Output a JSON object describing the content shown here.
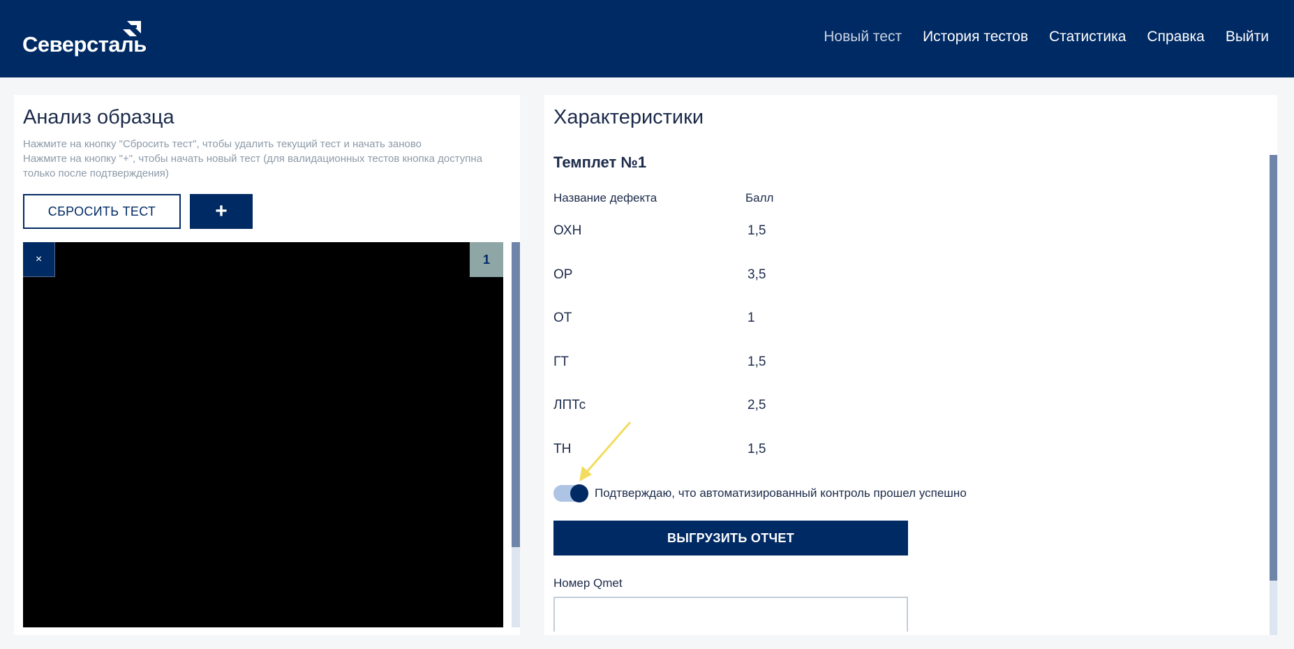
{
  "header": {
    "logo_text": "Северсталь",
    "nav": [
      "Новый тест",
      "История тестов",
      "Статистика",
      "Справка",
      "Выйти"
    ]
  },
  "left_panel": {
    "title": "Анализ образца",
    "hint_lines": [
      "Нажмите на кнопку \"Сбросить тест\", чтобы удалить текущий тест и начать заново",
      "Нажмите на кнопку \"+\", чтобы начать новый тест (для валидационных тестов кнопка доступна только после подтверждения)"
    ],
    "reset_label": "СБРОСИТЬ ТЕСТ",
    "add_label": "+",
    "viewer": {
      "close_label": "×",
      "index": "1"
    }
  },
  "right_panel": {
    "title": "Характеристики",
    "template_title": "Темплет №1",
    "columns": {
      "name": "Название дефекта",
      "score": "Балл"
    },
    "defects": [
      {
        "name": "ОХН",
        "score": "1,5"
      },
      {
        "name": "ОР",
        "score": "3,5"
      },
      {
        "name": "ОТ",
        "score": "1"
      },
      {
        "name": "ГТ",
        "score": "1,5"
      },
      {
        "name": "ЛПТс",
        "score": "2,5"
      },
      {
        "name": "ТН",
        "score": "1,5"
      }
    ],
    "confirm_label": "Подтверждаю, что автоматизированный контроль прошел успешно",
    "confirm_on": true,
    "export_label": "ВЫГРУЗИТЬ ОТЧЕТ",
    "qmet_label": "Номер Qmet",
    "qmet_value": ""
  },
  "colors": {
    "brand": "#002a64",
    "background": "#f5f6f8",
    "annotation_arrow": "#f2dc5d"
  }
}
